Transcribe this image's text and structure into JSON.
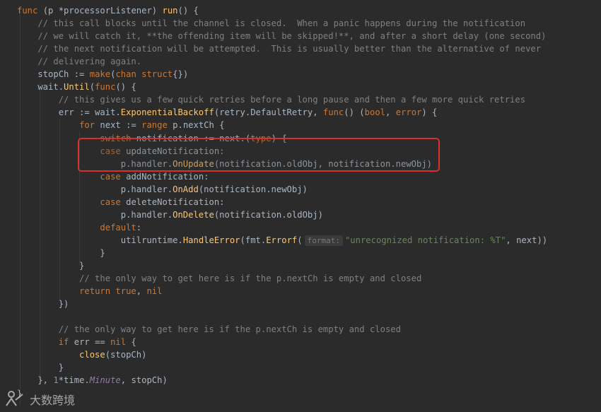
{
  "code": {
    "lines": [
      [
        {
          "t": "func",
          "c": "kw"
        },
        {
          "t": " (p ",
          "c": "id"
        },
        {
          "t": "*processorListener",
          "c": "id"
        },
        {
          "t": ") ",
          "c": "id"
        },
        {
          "t": "run",
          "c": "fn"
        },
        {
          "t": "() {",
          "c": "id"
        }
      ],
      [
        {
          "t": "    // this call blocks until the channel is closed.  When a panic happens during the notification",
          "c": "cm"
        }
      ],
      [
        {
          "t": "    // we will catch it, **the offending item will be skipped!**, and after a short delay (one second)",
          "c": "cm"
        }
      ],
      [
        {
          "t": "    // the next notification will be attempted.  This is usually better than the alternative of never",
          "c": "cm"
        }
      ],
      [
        {
          "t": "    // delivering again.",
          "c": "cm"
        }
      ],
      [
        {
          "t": "    stopCh := ",
          "c": "id"
        },
        {
          "t": "make",
          "c": "kw"
        },
        {
          "t": "(",
          "c": "id"
        },
        {
          "t": "chan struct",
          "c": "kw"
        },
        {
          "t": "{})",
          "c": "id"
        }
      ],
      [
        {
          "t": "    wait.",
          "c": "id"
        },
        {
          "t": "Until",
          "c": "method"
        },
        {
          "t": "(",
          "c": "id"
        },
        {
          "t": "func",
          "c": "kw"
        },
        {
          "t": "() {",
          "c": "id"
        }
      ],
      [
        {
          "t": "        // this gives us a few quick retries before a long pause and then a few more quick retries",
          "c": "cm"
        }
      ],
      [
        {
          "t": "        err := wait.",
          "c": "id"
        },
        {
          "t": "ExponentialBackoff",
          "c": "method"
        },
        {
          "t": "(retry.DefaultRetry, ",
          "c": "id"
        },
        {
          "t": "func",
          "c": "kw"
        },
        {
          "t": "() (",
          "c": "id"
        },
        {
          "t": "bool",
          "c": "kw"
        },
        {
          "t": ", ",
          "c": "id"
        },
        {
          "t": "error",
          "c": "kw"
        },
        {
          "t": ") {",
          "c": "id"
        }
      ],
      [
        {
          "t": "            ",
          "c": "id"
        },
        {
          "t": "for",
          "c": "kw"
        },
        {
          "t": " next := ",
          "c": "id"
        },
        {
          "t": "range",
          "c": "kw"
        },
        {
          "t": " p.nextCh {",
          "c": "id"
        }
      ],
      [
        {
          "t": "                ",
          "c": "id"
        },
        {
          "t": "switch",
          "c": "kw"
        },
        {
          "t": " notification := next.(",
          "c": "id"
        },
        {
          "t": "type",
          "c": "kw"
        },
        {
          "t": ") {",
          "c": "id"
        }
      ],
      [
        {
          "t": "                ",
          "c": "id"
        },
        {
          "t": "case",
          "c": "kw"
        },
        {
          "t": " updateNotification:",
          "c": "id"
        }
      ],
      [
        {
          "t": "                    p.handler.",
          "c": "id"
        },
        {
          "t": "OnUpdate",
          "c": "method"
        },
        {
          "t": "(notification.oldObj, notification.newObj)",
          "c": "id"
        }
      ],
      [
        {
          "t": "                ",
          "c": "id"
        },
        {
          "t": "case",
          "c": "kw"
        },
        {
          "t": " addNotification:",
          "c": "id"
        }
      ],
      [
        {
          "t": "                    p.handler.",
          "c": "id"
        },
        {
          "t": "OnAdd",
          "c": "method"
        },
        {
          "t": "(notification.newObj)",
          "c": "id"
        }
      ],
      [
        {
          "t": "                ",
          "c": "id"
        },
        {
          "t": "case",
          "c": "kw"
        },
        {
          "t": " deleteNotification:",
          "c": "id"
        }
      ],
      [
        {
          "t": "                    p.handler.",
          "c": "id"
        },
        {
          "t": "OnDelete",
          "c": "method"
        },
        {
          "t": "(notification.oldObj)",
          "c": "id"
        }
      ],
      [
        {
          "t": "                ",
          "c": "id"
        },
        {
          "t": "default",
          "c": "kw"
        },
        {
          "t": ":",
          "c": "id"
        }
      ],
      [
        {
          "t": "                    utilruntime.",
          "c": "id"
        },
        {
          "t": "HandleError",
          "c": "method"
        },
        {
          "t": "(fmt.",
          "c": "id"
        },
        {
          "t": "Errorf",
          "c": "method"
        },
        {
          "t": "(",
          "c": "id"
        },
        {
          "t": "format:",
          "c": "hint"
        },
        {
          "t": "\"unrecognized notification: %T\"",
          "c": "str"
        },
        {
          "t": ", next))",
          "c": "id"
        }
      ],
      [
        {
          "t": "                }",
          "c": "id"
        }
      ],
      [
        {
          "t": "            }",
          "c": "id"
        }
      ],
      [
        {
          "t": "            // the only way to get here is if the p.nextCh is empty and closed",
          "c": "cm"
        }
      ],
      [
        {
          "t": "            ",
          "c": "id"
        },
        {
          "t": "return true",
          "c": "kw"
        },
        {
          "t": ", ",
          "c": "id"
        },
        {
          "t": "nil",
          "c": "kw"
        }
      ],
      [
        {
          "t": "        })",
          "c": "id"
        }
      ],
      [
        {
          "t": "",
          "c": "id"
        }
      ],
      [
        {
          "t": "        // the only way to get here is if the p.nextCh is empty and closed",
          "c": "cm"
        }
      ],
      [
        {
          "t": "        ",
          "c": "id"
        },
        {
          "t": "if",
          "c": "kw"
        },
        {
          "t": " err == ",
          "c": "id"
        },
        {
          "t": "nil",
          "c": "kw"
        },
        {
          "t": " {",
          "c": "id"
        }
      ],
      [
        {
          "t": "            close",
          "c": "method"
        },
        {
          "t": "(stopCh)",
          "c": "id"
        }
      ],
      [
        {
          "t": "        }",
          "c": "id"
        }
      ],
      [
        {
          "t": "    }, ",
          "c": "id"
        },
        {
          "t": "1",
          "c": "num"
        },
        {
          "t": "*time.",
          "c": "id"
        },
        {
          "t": "Minute",
          "c": "italic"
        },
        {
          "t": ", stopCh)",
          "c": "id"
        }
      ],
      [
        {
          "t": "}",
          "c": "id"
        }
      ]
    ]
  },
  "watermark": {
    "text": "大数跨境"
  },
  "colors": {
    "background": "#2b2b2b",
    "keyword": "#cc7832",
    "function": "#ffc66d",
    "comment": "#808080",
    "string": "#6a8759",
    "number": "#6897bb",
    "highlight_box": "#d9302c"
  }
}
